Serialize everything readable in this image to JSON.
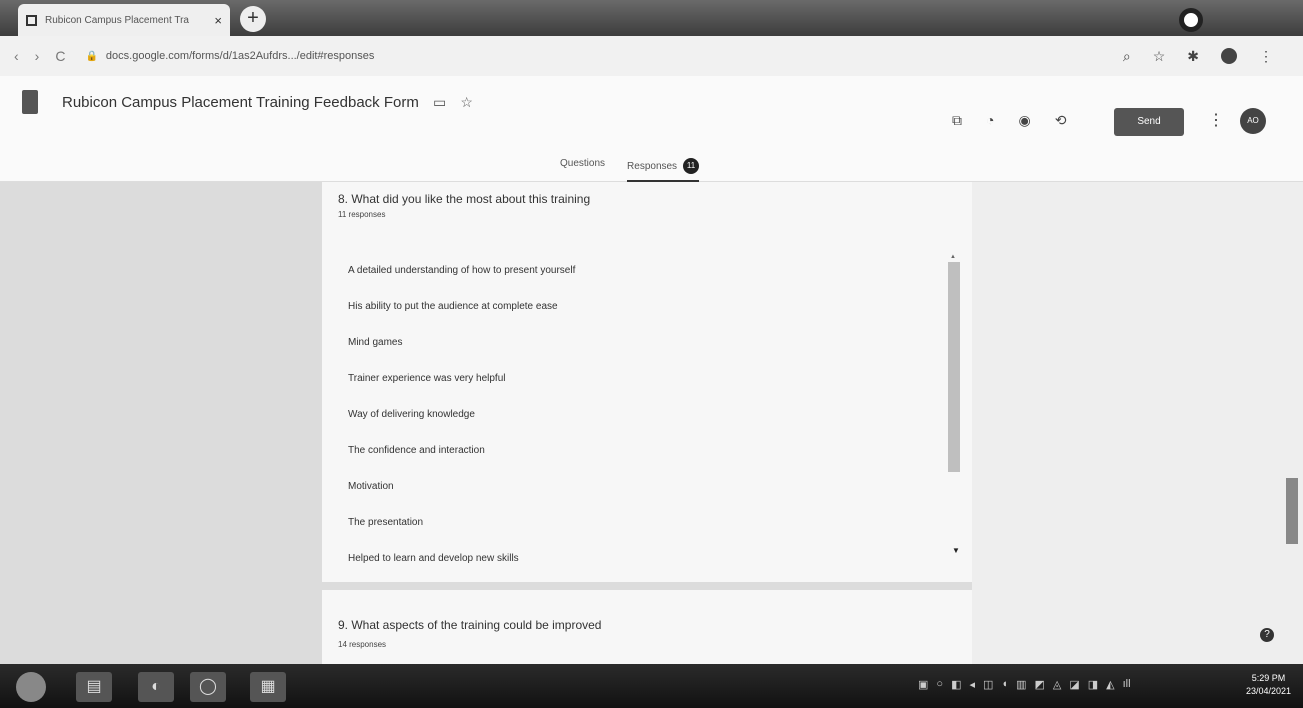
{
  "browser": {
    "tab_title": "Rubicon Campus Placement Tra",
    "tab_close": "×",
    "new_tab": "+",
    "url": "docs.google.com/forms/d/1as2Aufdrs.../edit#responses",
    "back": "‹",
    "forward": "›",
    "reload": "C",
    "lock": "🔒",
    "zoom_icon": "⌕",
    "bookmark_icon": "☆",
    "extensions_icon": "✱",
    "menu_icon": "⋮"
  },
  "form": {
    "title": "Rubicon Campus Placement Training Feedback Form",
    "folder_icon": "▭",
    "star_icon": "☆",
    "tool_icons": [
      "⧉",
      "◔",
      "◉",
      "⟲"
    ],
    "send_label": "Send",
    "more_icon": "⋮",
    "avatar_text": "AO",
    "tabs": {
      "questions": "Questions",
      "responses": "Responses",
      "responses_count": "11"
    }
  },
  "q8": {
    "title": "8. What did you like the most about this training",
    "count": "11 responses",
    "answers": [
      "A detailed understanding of how to present yourself",
      "His ability to put the audience at complete ease",
      "Mind games",
      "Trainer experience was very helpful",
      "Way of delivering knowledge",
      "The confidence and interaction",
      "Motivation",
      "The presentation",
      "Helped to learn and develop new skills"
    ],
    "scroll_up": "▲",
    "scroll_down": "▼"
  },
  "q9": {
    "title": "9. What aspects of the training could be improved",
    "count": "14 responses"
  },
  "help_icon": "?",
  "taskbar": {
    "apps": [
      "▤",
      "◐",
      "◯",
      "▦"
    ],
    "tray": [
      "▣",
      "○",
      "◧",
      "◂",
      "◫",
      "◖",
      "▥",
      "◩",
      "◬",
      "◪",
      "◨",
      "◭",
      "ıll"
    ],
    "time": "5:29 PM",
    "date": "23/04/2021"
  }
}
